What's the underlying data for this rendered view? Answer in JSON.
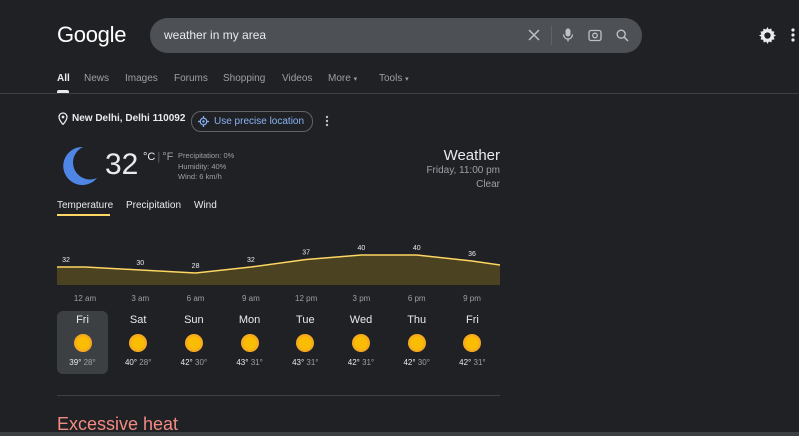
{
  "header": {
    "logo": "Google",
    "search": {
      "value": "weather in my area"
    },
    "tabs": [
      "All",
      "News",
      "Images",
      "Forums",
      "Shopping",
      "Videos",
      "More",
      "Tools"
    ]
  },
  "location": {
    "name": "New Delhi, Delhi 110092",
    "precise_label": "Use precise location"
  },
  "current": {
    "icon": "moon-icon",
    "temp": "32",
    "unit_c": "°C",
    "unit_sep": "|",
    "unit_f": "°F",
    "precipitation": "Precipitation: 0%",
    "humidity": "Humidity: 40%",
    "wind": "Wind: 6 km/h",
    "title": "Weather",
    "time": "Friday, 11:00 pm",
    "condition": "Clear"
  },
  "weather_tabs": [
    "Temperature",
    "Precipitation",
    "Wind"
  ],
  "chart_data": {
    "type": "area",
    "x": [
      "12 am",
      "3 am",
      "6 am",
      "9 am",
      "12 pm",
      "3 pm",
      "6 pm",
      "9 pm"
    ],
    "labels": [
      "32",
      "30",
      "28",
      "32",
      "37",
      "40",
      "40",
      "36"
    ],
    "values": [
      32,
      30,
      28,
      32,
      37,
      40,
      40,
      36
    ],
    "color": "#fdd663"
  },
  "forecast": [
    {
      "day": "Fri",
      "hi": "39°",
      "lo": "28°"
    },
    {
      "day": "Sat",
      "hi": "40°",
      "lo": "28°"
    },
    {
      "day": "Sun",
      "hi": "42°",
      "lo": "30°"
    },
    {
      "day": "Mon",
      "hi": "43°",
      "lo": "31°"
    },
    {
      "day": "Tue",
      "hi": "43°",
      "lo": "31°"
    },
    {
      "day": "Wed",
      "hi": "42°",
      "lo": "31°"
    },
    {
      "day": "Thu",
      "hi": "42°",
      "lo": "30°"
    },
    {
      "day": "Fri",
      "hi": "42°",
      "lo": "31°"
    }
  ],
  "alert": {
    "title": "Excessive heat"
  }
}
